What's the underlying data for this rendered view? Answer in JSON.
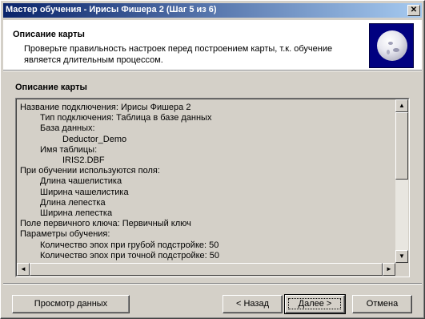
{
  "window": {
    "title": "Мастер обучения - Ирисы Фишера 2 (Шаг 5 из 6)",
    "close_glyph": "✕"
  },
  "header": {
    "title": "Описание карты",
    "description": "Проверьте правильность настроек перед построением карты, т.к. обучение является длительным процессом.",
    "logo_icon": "globe-icon"
  },
  "section": {
    "label": "Описание карты"
  },
  "description_lines": [
    {
      "indent": 0,
      "text": "Название подключения: Ирисы Фишера 2"
    },
    {
      "indent": 1,
      "text": "Тип подключения: Таблица в базе данных"
    },
    {
      "indent": 1,
      "text": "База данных:"
    },
    {
      "indent": 2,
      "text": "Deductor_Demo"
    },
    {
      "indent": 1,
      "text": "Имя таблицы:"
    },
    {
      "indent": 2,
      "text": "IRIS2.DBF"
    },
    {
      "indent": 0,
      "text": "При обучении используются поля:"
    },
    {
      "indent": 1,
      "text": "Длина чашелистика"
    },
    {
      "indent": 1,
      "text": "Ширина чашелистика"
    },
    {
      "indent": 1,
      "text": "Длина лепестка"
    },
    {
      "indent": 1,
      "text": "Ширина лепестка"
    },
    {
      "indent": 0,
      "text": "Поле первичного ключа: Первичный ключ"
    },
    {
      "indent": 0,
      "text": "Параметры обучения:"
    },
    {
      "indent": 1,
      "text": " Количество эпох при грубой подстройке: 50"
    },
    {
      "indent": 1,
      "text": "Количество эпох при точной подстройке: 50"
    }
  ],
  "scrollbars": {
    "up_glyph": "▲",
    "down_glyph": "▼",
    "left_glyph": "◄",
    "right_glyph": "►"
  },
  "buttons": {
    "preview": "Просмотр данных",
    "back": "< Назад",
    "next": "Далее >",
    "cancel": "Отмена"
  }
}
